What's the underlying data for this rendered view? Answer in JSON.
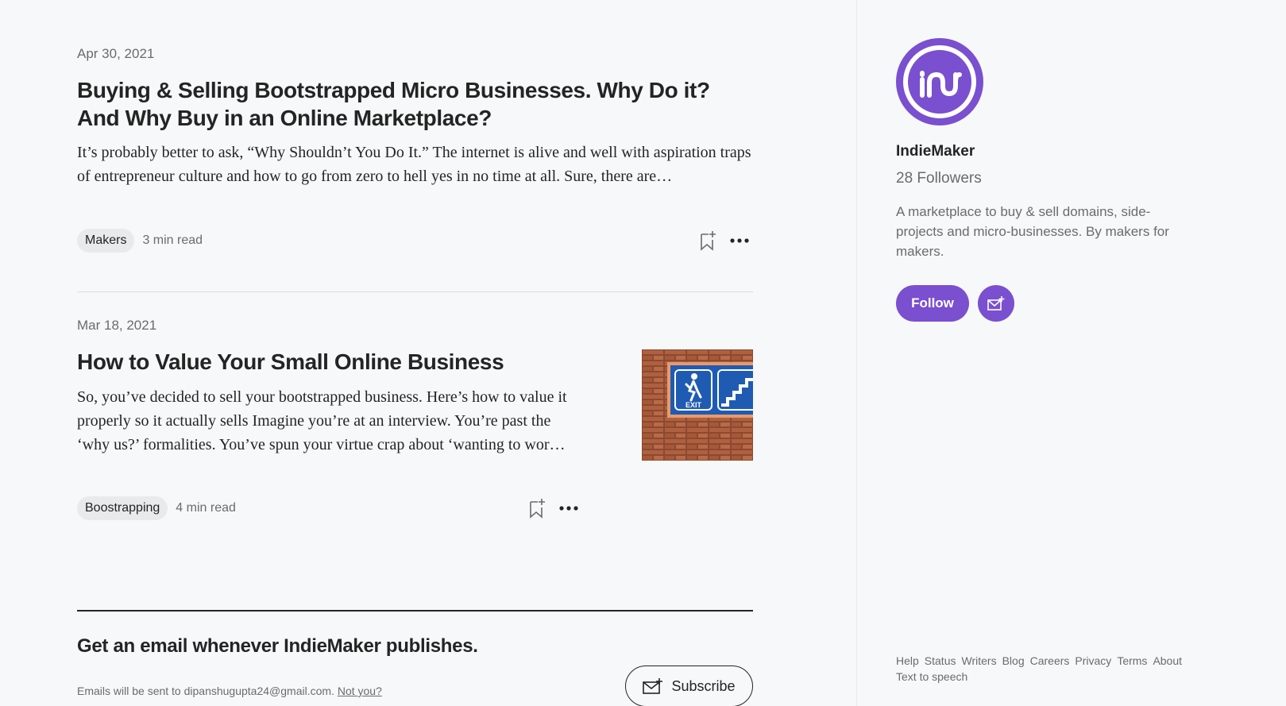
{
  "articles": [
    {
      "date": "Apr 30, 2021",
      "title": "Buying & Selling Bootstrapped Micro Businesses. Why Do it? And Why Buy in an Online Marketplace?",
      "excerpt": "It’s probably better to ask, “Why Shouldn’t You Do It.” The internet is alive and well with aspiration traps of entrepreneur culture and how to go from zero to hell yes in no time at all. Sure, there are…",
      "tag": "Makers",
      "read_time": "3 min read"
    },
    {
      "date": "Mar 18, 2021",
      "title": "How to Value Your Small Online Business",
      "excerpt": "So, you’ve decided to sell your bootstrapped business. Here’s how to value it properly so it actually sells Imagine you’re at an interview. You’re past the ‘why us?’ formalities. You’ve spun your virtue crap about ‘wanting to wor…",
      "tag": "Boostrapping",
      "read_time": "4 min read",
      "thumbnail_sign": "EXIT"
    }
  ],
  "subscribe": {
    "title": "Get an email whenever IndieMaker publishes.",
    "note": "Emails will be sent to dipanshugupta24@gmail.com.",
    "not_you": "Not you?",
    "button_label": "Subscribe"
  },
  "sidebar": {
    "name": "IndieMaker",
    "followers": "28 Followers",
    "about": "A marketplace to buy & sell domains, side-projects and micro-businesses. By makers for makers.",
    "follow_label": "Follow",
    "footer_links": [
      "Help",
      "Status",
      "Writers",
      "Blog",
      "Careers",
      "Privacy",
      "Terms",
      "About",
      "Text to speech"
    ]
  },
  "colors": {
    "accent": "#7a4fd0",
    "text": "#242424",
    "muted": "#6b6b6b",
    "background": "#f7f8f9"
  },
  "icons": [
    "bookmark-add-icon",
    "more-options-icon",
    "mail-plus-icon",
    "indiemaker-logo"
  ]
}
